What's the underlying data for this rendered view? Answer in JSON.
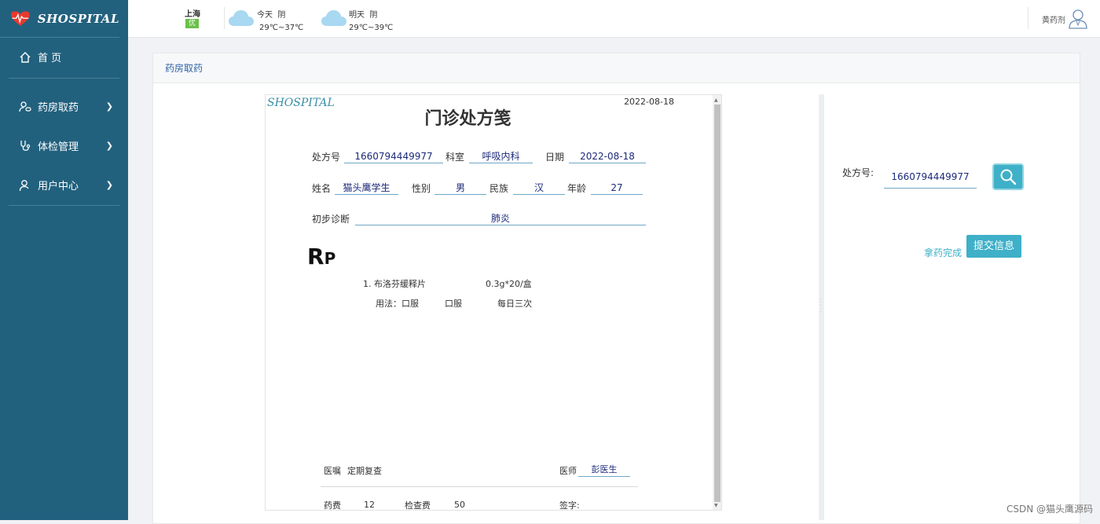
{
  "app": {
    "logo_text": "SHOSPITAL"
  },
  "sidebar": {
    "items": [
      {
        "label": "首 页",
        "icon": "home-icon"
      },
      {
        "label": "药房取药",
        "icon": "user-pill-icon"
      },
      {
        "label": "体检管理",
        "icon": "stethoscope-icon"
      },
      {
        "label": "用户中心",
        "icon": "user-icon"
      }
    ]
  },
  "header": {
    "city": "上海",
    "aqi": "优",
    "today": {
      "label": "今天",
      "weather": "阴",
      "temp": "29℃~37℃"
    },
    "tomorrow": {
      "label": "明天",
      "weather": "阴",
      "temp": "29℃~39℃"
    },
    "user_name": "黄药剂"
  },
  "panel": {
    "title": "药房取药"
  },
  "prescription": {
    "logo": "SHOSPITAL",
    "date": "2022-08-18",
    "title": "门诊处方笺",
    "labels": {
      "rx_no": "处方号",
      "dept": "科室",
      "date": "日期",
      "name": "姓名",
      "gender": "性别",
      "ethnicity": "民族",
      "age": "年龄",
      "diagnosis": "初步诊断",
      "advice": "医嘱",
      "doctor": "医师",
      "drug_fee": "药费",
      "exam_fee": "检查费",
      "signature": "签字:"
    },
    "rx_no": "1660794449977",
    "dept": "呼吸内科",
    "visit_date": "2022-08-18",
    "name": "猫头鹰学生",
    "gender": "男",
    "ethnicity": "汉",
    "age": "27",
    "diagnosis": "肺炎",
    "rp_main": "R",
    "rp_sub": "P",
    "drugs": [
      {
        "line": "1. 布洛芬缓释片",
        "spec": "0.3g*20/盒",
        "usage_label": "用法：口服",
        "usage_route": "口服",
        "frequency": "每日三次"
      }
    ],
    "advice": "定期复查",
    "doctor": "彭医生",
    "drug_fee": "12",
    "exam_fee": "50"
  },
  "search": {
    "label": "处方号:",
    "value": "1660794449977"
  },
  "actions": {
    "done_label": "拿药完成",
    "submit_label": "提交信息"
  },
  "watermark": "CSDN @猫头鹰源码"
}
